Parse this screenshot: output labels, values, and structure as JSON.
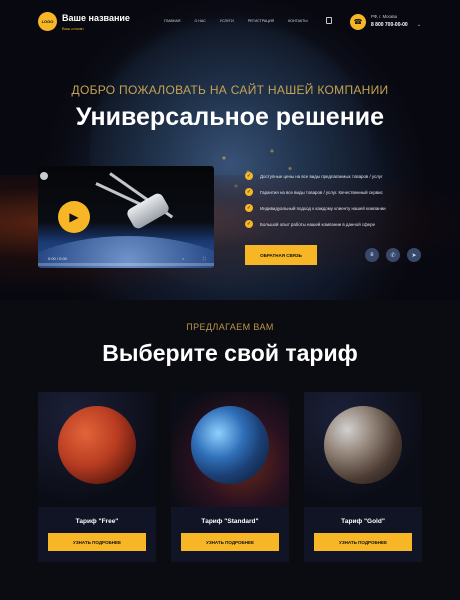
{
  "header": {
    "logo_text": "LOGO",
    "title": "Ваше название",
    "subtitle": "Ваш слоган",
    "nav": [
      "ГЛАВНАЯ",
      "О НАС",
      "УСЛУГИ",
      "РЕГИСТРАЦИЯ",
      "КОНТАКТЫ"
    ],
    "city": "РФ, г. Москва",
    "phone": "8 800 700-00-00"
  },
  "hero": {
    "kicker": "ДОБРО ПОЖАЛОВАТЬ НА САЙТ НАШЕЙ КОМПАНИИ",
    "title": "Универсальное решение",
    "video_time": "0:00 / 0:00",
    "features": [
      "Доступные цены на все виды предлагаемых товаров / услуг",
      "Гарантия на все виды товаров / услуг. Качественный сервис",
      "Индивидуальный подход к каждому клиенту нашей компании",
      "Большой опыт работы нашей компании в данной сфере"
    ],
    "cta_label": "ОБРАТНАЯ СВЯЗЬ"
  },
  "tariffs": {
    "kicker": "ПРЕДЛАГАЕМ ВАМ",
    "title": "Выберите свой тариф",
    "cards": [
      {
        "name": "Тариф \"Free\"",
        "button": "УЗНАТЬ ПОДРОБНЕЕ"
      },
      {
        "name": "Тариф \"Standard\"",
        "button": "УЗНАТЬ ПОДРОБНЕЕ"
      },
      {
        "name": "Тариф \"Gold\"",
        "button": "УЗНАТЬ ПОДРОБНЕЕ"
      }
    ]
  },
  "colors": {
    "accent": "#f7b626",
    "background": "#0b0b12",
    "card": "#101424"
  },
  "icons": {
    "cart": "cart-icon",
    "phone": "phone-icon",
    "play": "play-icon",
    "check": "check-icon",
    "social": [
      "vk-icon",
      "viber-icon",
      "telegram-icon"
    ]
  }
}
